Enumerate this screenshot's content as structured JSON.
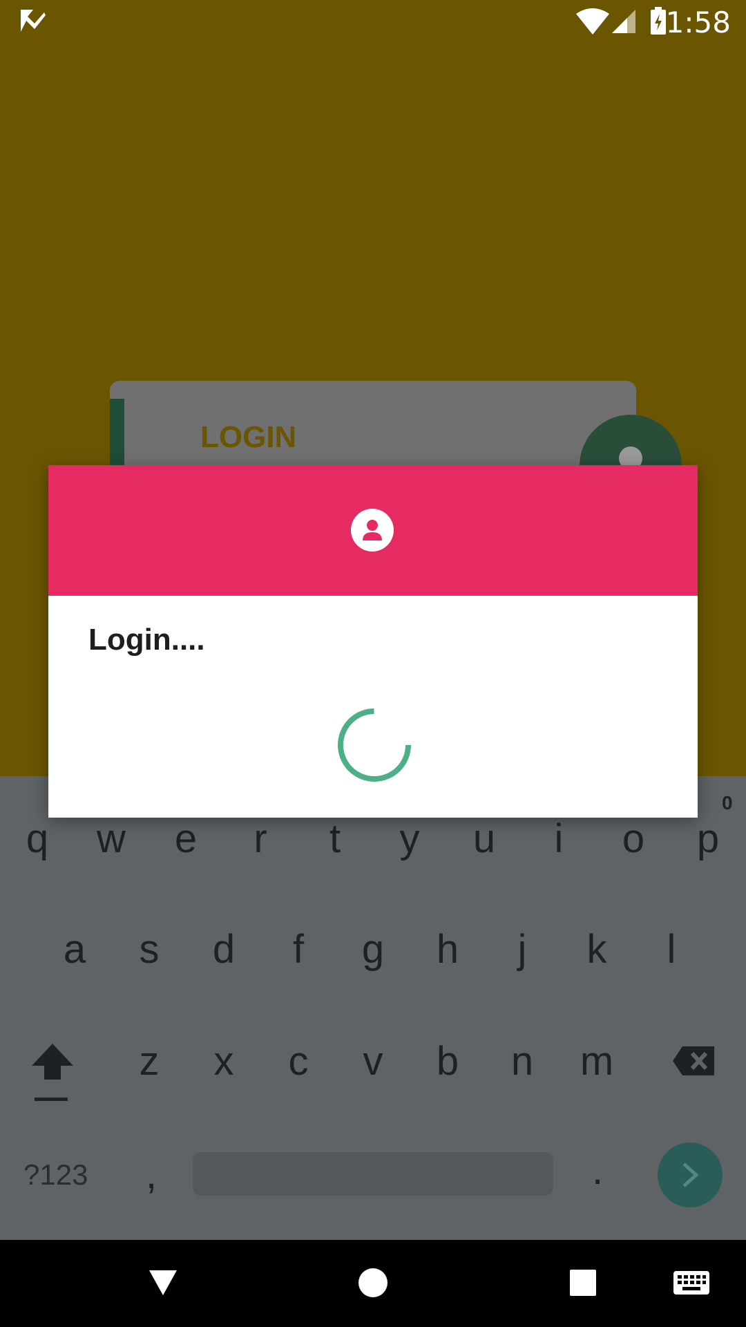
{
  "status_bar": {
    "time": "1:58",
    "icons": [
      "app-check-icon",
      "wifi-icon",
      "signal-icon",
      "battery-charging-icon"
    ]
  },
  "background_app": {
    "card_title": "LOGIN"
  },
  "dialog": {
    "title": "Login....",
    "header_color": "#e62a62",
    "icon": "user-icon",
    "spinner_color": "#4caf86"
  },
  "keyboard": {
    "row1": [
      "q",
      "w",
      "e",
      "r",
      "t",
      "y",
      "u",
      "i",
      "o",
      "p"
    ],
    "row1_hint": "0",
    "row2": [
      "a",
      "s",
      "d",
      "f",
      "g",
      "h",
      "j",
      "k",
      "l"
    ],
    "row3": [
      "z",
      "x",
      "c",
      "v",
      "b",
      "n",
      "m"
    ],
    "symbols_key": "?123",
    "comma_key": ",",
    "period_key": ".",
    "icons": [
      "shift-icon",
      "backspace-icon",
      "enter-arrow-icon"
    ]
  },
  "nav_bar": {
    "icons": [
      "back-icon",
      "home-icon",
      "recents-icon",
      "keyboard-icon"
    ]
  }
}
